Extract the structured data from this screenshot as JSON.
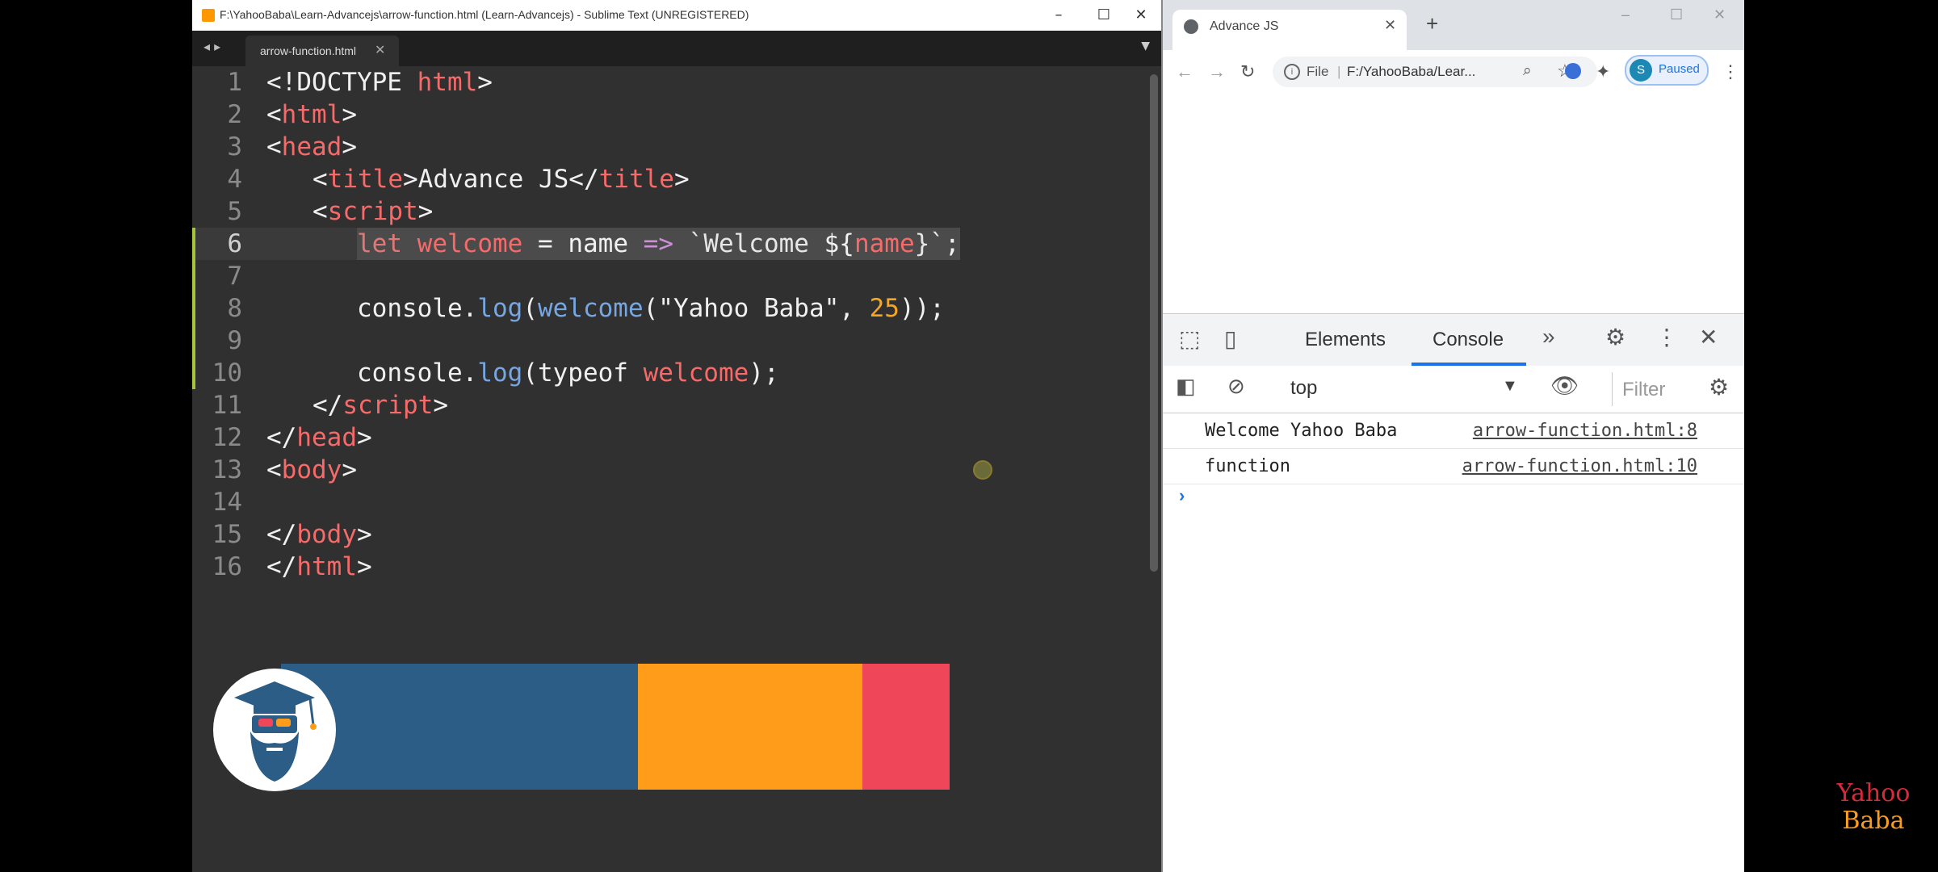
{
  "sublime": {
    "title": "F:\\YahooBaba\\Learn-Advancejs\\arrow-function.html (Learn-Advancejs) - Sublime Text (UNREGISTERED)",
    "tab_label": "arrow-function.html",
    "line_numbers": [
      "1",
      "2",
      "3",
      "4",
      "5",
      "6",
      "7",
      "8",
      "9",
      "10",
      "11",
      "12",
      "13",
      "14",
      "15",
      "16"
    ],
    "code": {
      "l1": [
        "<!DOCTYPE ",
        "html",
        ">"
      ],
      "l2": [
        "<",
        "html",
        ">"
      ],
      "l3": [
        "<",
        "head",
        ">"
      ],
      "l4": [
        "<",
        "title",
        ">Advance JS</",
        "title",
        ">"
      ],
      "l5": [
        "<",
        "script",
        ">"
      ],
      "l6": [
        "let",
        " ",
        "welcome",
        " = ",
        "name",
        " ",
        "=>",
        " ",
        "`Welcome ",
        "${",
        "name",
        "}`",
        ";"
      ],
      "l8": [
        "console.",
        "log",
        "(",
        "welcome",
        "(\"Yahoo Baba\", ",
        "25",
        "));"
      ],
      "l10": [
        "console.",
        "log",
        "(typeof ",
        "welcome",
        ");"
      ],
      "l11": [
        "</",
        "script",
        ">"
      ],
      "l12": [
        "</",
        "head",
        ">"
      ],
      "l13": [
        "<",
        "body",
        ">"
      ],
      "l15": [
        "</",
        "body",
        ">"
      ],
      "l16": [
        "</",
        "html",
        ">"
      ]
    }
  },
  "chrome": {
    "tab_title": "Advance JS",
    "address_scheme": "File",
    "address_url": "F:/YahooBaba/Lear...",
    "profile_initial": "S",
    "profile_status": "Paused"
  },
  "devtools": {
    "tabs": [
      "Elements",
      "Console"
    ],
    "context": "top",
    "filter_placeholder": "Filter",
    "messages": [
      {
        "text": "Welcome Yahoo Baba",
        "source": "arrow-function.html:8"
      },
      {
        "text": "function",
        "source": "arrow-function.html:10"
      }
    ],
    "prompt": "›"
  },
  "watermark": {
    "line1": "Yahoo",
    "line2": "Baba"
  },
  "colors": {
    "editor_bg": "#303030",
    "tag": "#f66a6a",
    "function": "#77a7e3",
    "number": "#f5a623",
    "banner_blue": "#2b5d86",
    "banner_orange": "#ff9c1a",
    "banner_red": "#f0465a",
    "devtools_accent": "#1a73e8"
  }
}
